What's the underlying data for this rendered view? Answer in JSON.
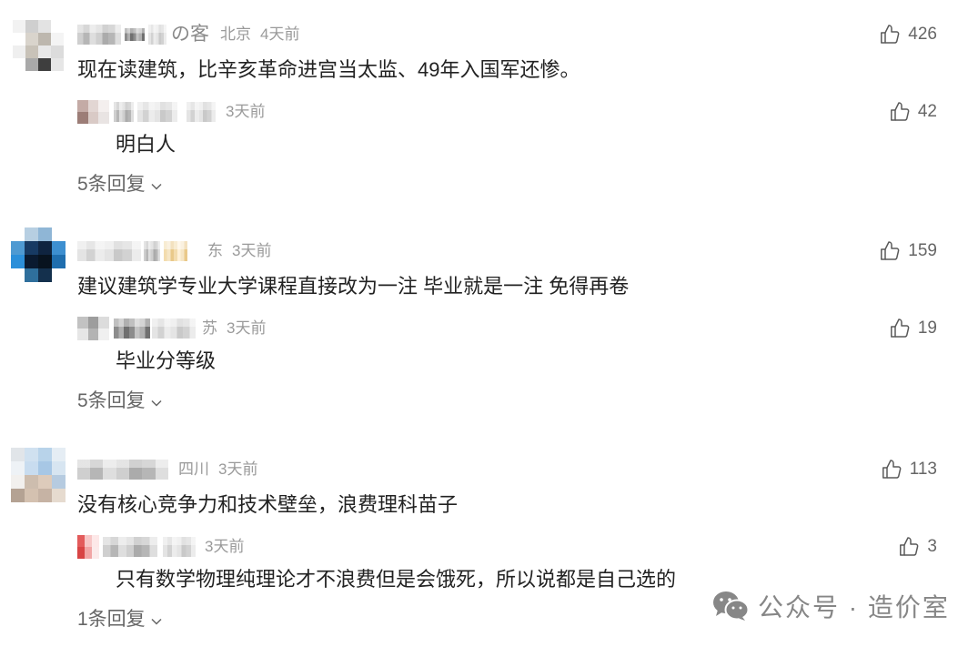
{
  "theme": {
    "text": "#222222",
    "meta": "#9a9a9a",
    "secondary": "#666666",
    "watermark": "#7c7c7c"
  },
  "icons": {
    "like": "thumbs-up-icon",
    "expand": "chevron-down-icon",
    "watermark": "wechat-icon"
  },
  "comments": [
    {
      "author": {
        "name_visible": "の客"
      },
      "location": "北京",
      "time": "4天前",
      "likes": "426",
      "text": "现在读建筑，比辛亥革命进宫当太监、49年入国军还惨。",
      "top_reply": {
        "time": "3天前",
        "likes": "42",
        "text": "明白人"
      },
      "more_replies": "5条回复"
    },
    {
      "location": "东",
      "time": "3天前",
      "likes": "159",
      "text": "建议建筑学专业大学课程直接改为一注 毕业就是一注 免得再卷",
      "top_reply": {
        "location": "苏",
        "time": "3天前",
        "likes": "19",
        "text": "毕业分等级"
      },
      "more_replies": "5条回复"
    },
    {
      "location": "四川",
      "time": "3天前",
      "likes": "113",
      "text": "没有核心竞争力和技术壁垒，浪费理科苗子",
      "top_reply": {
        "time": "3天前",
        "likes": "3",
        "text": "只有数学物理纯理论才不浪费但是会饿死，所以说都是自己选的"
      },
      "more_replies": "1条回复"
    }
  ],
  "watermark": {
    "text": "公众号 · 造价室"
  }
}
